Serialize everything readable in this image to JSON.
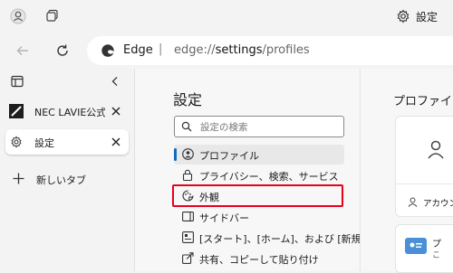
{
  "top": {
    "settings_label": "設定"
  },
  "address": {
    "site_name": "Edge",
    "separator": "|",
    "url_prefix": "edge://",
    "url_bold": "settings",
    "url_suffix": "/profiles"
  },
  "vtabs": {
    "tabs": [
      {
        "label": "NEC LAVIE公式"
      },
      {
        "label": "設定"
      }
    ],
    "new_tab_label": "新しいタブ"
  },
  "settings": {
    "title": "設定",
    "search_placeholder": "設定の検索",
    "nav": [
      {
        "label": "プロファイル",
        "icon": "profile-icon"
      },
      {
        "label": "プライバシー、検索、サービス",
        "icon": "lock-icon"
      },
      {
        "label": "外観",
        "icon": "appearance-icon"
      },
      {
        "label": "サイドバー",
        "icon": "sidebar-icon"
      },
      {
        "label": "[スタート]、[ホーム]、および [新規] タブ",
        "icon": "home-icon"
      },
      {
        "label": "共有、コピーして貼り付け",
        "icon": "share-icon"
      }
    ]
  },
  "profile_pane": {
    "title": "プロファイル",
    "account_label": "アカウン",
    "card_label_1": "プ",
    "card_label_2": "こ"
  },
  "colors": {
    "highlight": "#e8001c",
    "accent": "#0f6cbd"
  }
}
